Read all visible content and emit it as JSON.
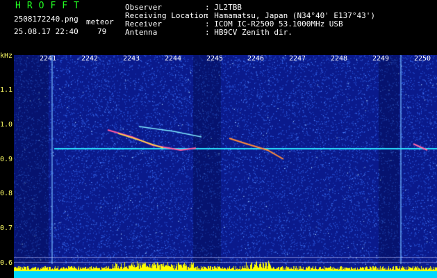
{
  "header": {
    "title": "HROFFT",
    "filename": "2508172240.png",
    "mode": "meteor",
    "datetime": "25.08.17 22:40",
    "count": "79",
    "fields": [
      {
        "label": "Observer",
        "value": ": JL2TBB"
      },
      {
        "label": "Receiving Location",
        "value": ": Hamamatsu, Japan (N34°40' E137°43')"
      },
      {
        "label": "Receiver",
        "value": ": ICOM IC-R2500 53.1000MHz USB"
      },
      {
        "label": "Antenna",
        "value": ": HB9CV Zenith dir."
      }
    ]
  },
  "axes": {
    "y_unit": "kHz",
    "y_ticks": [
      "1.1",
      "1.0",
      "0.9",
      "0.8",
      "0.7",
      "0.6"
    ],
    "x_ticks": [
      "2241",
      "2242",
      "2243",
      "2244",
      "2245",
      "2246",
      "2247",
      "2248",
      "2249",
      "2250"
    ]
  },
  "colors": {
    "background": "#0a1a8c",
    "noise": "#3a6cff",
    "carrier": "#29e0ff",
    "trail": "#ffe040",
    "level_bar": "#ffff00",
    "cyan_band": "#00d8ff"
  }
}
